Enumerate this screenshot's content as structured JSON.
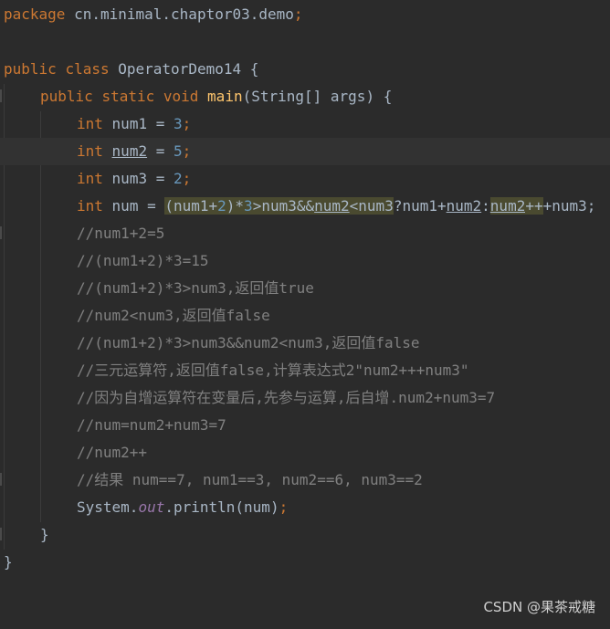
{
  "code": {
    "package": {
      "kw": "package",
      "name": "cn.minimal.chaptor03.demo",
      "semi": ";"
    },
    "class_decl": {
      "kw1": "public",
      "kw2": "class",
      "name": "OperatorDemo14",
      "brace": "{"
    },
    "main_decl": {
      "kw1": "public",
      "kw2": "static",
      "kw3": "void",
      "fn": "main",
      "params": "(String[] args)",
      "brace": "{"
    },
    "decl1": {
      "type": "int",
      "name": "num1",
      "op": " = ",
      "value": "3",
      "semi": ";"
    },
    "decl2": {
      "type": "int",
      "name": "num2",
      "op": " = ",
      "value": "5",
      "semi": ";"
    },
    "decl3": {
      "type": "int",
      "name": "num3",
      "op": " = ",
      "value": "2",
      "semi": ";"
    },
    "expr": {
      "type": "int",
      "lhs": "num = ",
      "p1": "(num1+",
      "p2": "2",
      "p3": ")*",
      "p4": "3",
      "p5": ">num3&&",
      "p6": "num2",
      "p7": "<num3",
      "p8": "?num1+",
      "p9": "num2",
      "p10": ":",
      "p11": "num2",
      "p12": "++",
      "p13": "+num3;"
    },
    "comments": [
      "//num1+2=5",
      "//(num1+2)*3=15",
      "//(num1+2)*3>num3,返回值true",
      "//num2<num3,返回值false",
      "//(num1+2)*3>num3&&num2<num3,返回值false",
      "//三元运算符,返回值false,计算表达式2\"num2+++num3\"",
      "//因为自增运算符在变量后,先参与运算,后自增.num2+num3=7",
      "//num=num2+num3=7",
      "//num2++",
      "//结果 num==7, num1==3, num2==6, num3==2"
    ],
    "println": {
      "obj": "System.",
      "field": "out",
      "call": ".println(num)",
      "semi": ";"
    },
    "close_main": "}",
    "close_class": "}"
  },
  "watermark": "CSDN @果茶戒糖"
}
